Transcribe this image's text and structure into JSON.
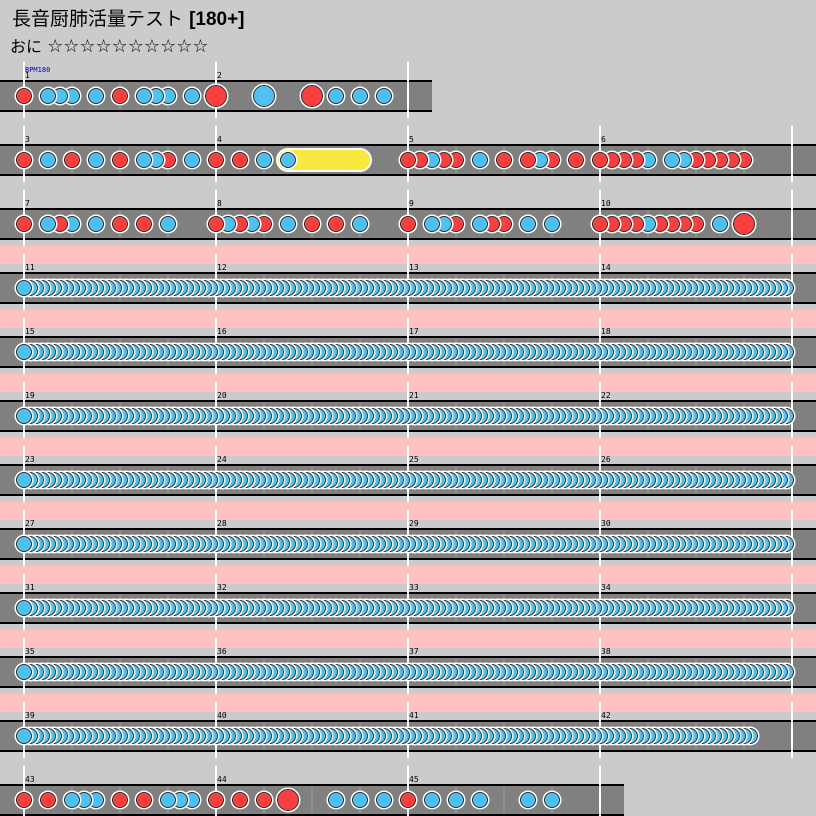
{
  "song": {
    "title": "長音厨肺活量テスト",
    "bpm_label": "[180+]"
  },
  "difficulty": {
    "name": "おに",
    "stars": "☆☆☆☆☆☆☆☆☆☆",
    "star_count": 10
  },
  "colors": {
    "background": "#cbcbcb",
    "lane": "#808080",
    "lane_border": "#000000",
    "roll_highlight": "#ffc0c0",
    "don": "#f84040",
    "ka": "#50c0f0",
    "drumroll": "#f8e840",
    "bpm_label": "#0000c0"
  },
  "chart_data": {
    "type": "taiko-chart",
    "bpm_marker": "BPM180",
    "measures_per_row": 4,
    "rows": [
      {
        "measures": [
          1,
          2
        ],
        "highlight": false,
        "notes": [
          {
            "m": 1,
            "p": 0.0,
            "t": "don"
          },
          {
            "m": 1,
            "p": 0.125,
            "t": "ka"
          },
          {
            "m": 1,
            "p": 0.1875,
            "t": "ka"
          },
          {
            "m": 1,
            "p": 0.25,
            "t": "ka"
          },
          {
            "m": 1,
            "p": 0.375,
            "t": "ka"
          },
          {
            "m": 1,
            "p": 0.5,
            "t": "don"
          },
          {
            "m": 1,
            "p": 0.625,
            "t": "ka"
          },
          {
            "m": 1,
            "p": 0.6875,
            "t": "ka"
          },
          {
            "m": 1,
            "p": 0.75,
            "t": "ka"
          },
          {
            "m": 1,
            "p": 0.875,
            "t": "ka"
          },
          {
            "m": 2,
            "p": 0.0,
            "t": "DON"
          },
          {
            "m": 2,
            "p": 0.25,
            "t": "KA"
          },
          {
            "m": 2,
            "p": 0.5,
            "t": "DON"
          },
          {
            "m": 2,
            "p": 0.625,
            "t": "ka"
          },
          {
            "m": 2,
            "p": 0.75,
            "t": "ka"
          },
          {
            "m": 2,
            "p": 0.875,
            "t": "ka"
          }
        ]
      },
      {
        "measures": [
          3,
          4,
          5,
          6
        ],
        "highlight": false,
        "rolls": [
          {
            "m": 4,
            "start": 0.375,
            "end": 0.75
          }
        ],
        "notes": [
          {
            "m": 3,
            "p": 0.0,
            "t": "don"
          },
          {
            "m": 3,
            "p": 0.125,
            "t": "ka"
          },
          {
            "m": 3,
            "p": 0.25,
            "t": "don"
          },
          {
            "m": 3,
            "p": 0.375,
            "t": "ka"
          },
          {
            "m": 3,
            "p": 0.5,
            "t": "don"
          },
          {
            "m": 3,
            "p": 0.625,
            "t": "ka"
          },
          {
            "m": 3,
            "p": 0.6875,
            "t": "ka"
          },
          {
            "m": 3,
            "p": 0.75,
            "t": "don"
          },
          {
            "m": 3,
            "p": 0.875,
            "t": "ka"
          },
          {
            "m": 4,
            "p": 0.0,
            "t": "don"
          },
          {
            "m": 4,
            "p": 0.125,
            "t": "don"
          },
          {
            "m": 4,
            "p": 0.25,
            "t": "ka"
          },
          {
            "m": 4,
            "p": 0.375,
            "t": "ka"
          },
          {
            "m": 5,
            "p": 0.0,
            "t": "don"
          },
          {
            "m": 5,
            "p": 0.0625,
            "t": "don"
          },
          {
            "m": 5,
            "p": 0.125,
            "t": "ka"
          },
          {
            "m": 5,
            "p": 0.1875,
            "t": "don"
          },
          {
            "m": 5,
            "p": 0.25,
            "t": "don"
          },
          {
            "m": 5,
            "p": 0.375,
            "t": "ka"
          },
          {
            "m": 5,
            "p": 0.5,
            "t": "don"
          },
          {
            "m": 5,
            "p": 0.625,
            "t": "don"
          },
          {
            "m": 5,
            "p": 0.6875,
            "t": "ka"
          },
          {
            "m": 5,
            "p": 0.75,
            "t": "don"
          },
          {
            "m": 5,
            "p": 0.875,
            "t": "don"
          },
          {
            "m": 6,
            "p": 0.0,
            "t": "don"
          },
          {
            "m": 6,
            "p": 0.0625,
            "t": "don"
          },
          {
            "m": 6,
            "p": 0.125,
            "t": "don"
          },
          {
            "m": 6,
            "p": 0.1875,
            "t": "don"
          },
          {
            "m": 6,
            "p": 0.25,
            "t": "ka"
          },
          {
            "m": 6,
            "p": 0.375,
            "t": "ka"
          },
          {
            "m": 6,
            "p": 0.4375,
            "t": "ka"
          },
          {
            "m": 6,
            "p": 0.5,
            "t": "don"
          },
          {
            "m": 6,
            "p": 0.5625,
            "t": "don"
          },
          {
            "m": 6,
            "p": 0.625,
            "t": "don"
          },
          {
            "m": 6,
            "p": 0.6875,
            "t": "don"
          },
          {
            "m": 6,
            "p": 0.75,
            "t": "don"
          }
        ]
      },
      {
        "measures": [
          7,
          8,
          9,
          10
        ],
        "highlight": false,
        "notes": [
          {
            "m": 7,
            "p": 0.0,
            "t": "don"
          },
          {
            "m": 7,
            "p": 0.125,
            "t": "ka"
          },
          {
            "m": 7,
            "p": 0.1875,
            "t": "don"
          },
          {
            "m": 7,
            "p": 0.25,
            "t": "ka"
          },
          {
            "m": 7,
            "p": 0.375,
            "t": "ka"
          },
          {
            "m": 7,
            "p": 0.5,
            "t": "don"
          },
          {
            "m": 7,
            "p": 0.625,
            "t": "don"
          },
          {
            "m": 7,
            "p": 0.75,
            "t": "ka"
          },
          {
            "m": 8,
            "p": 0.0,
            "t": "don"
          },
          {
            "m": 8,
            "p": 0.0625,
            "t": "ka"
          },
          {
            "m": 8,
            "p": 0.125,
            "t": "don"
          },
          {
            "m": 8,
            "p": 0.1875,
            "t": "ka"
          },
          {
            "m": 8,
            "p": 0.25,
            "t": "don"
          },
          {
            "m": 8,
            "p": 0.375,
            "t": "ka"
          },
          {
            "m": 8,
            "p": 0.5,
            "t": "don"
          },
          {
            "m": 8,
            "p": 0.625,
            "t": "don"
          },
          {
            "m": 8,
            "p": 0.75,
            "t": "ka"
          },
          {
            "m": 9,
            "p": 0.0,
            "t": "don"
          },
          {
            "m": 9,
            "p": 0.125,
            "t": "ka"
          },
          {
            "m": 9,
            "p": 0.1875,
            "t": "ka"
          },
          {
            "m": 9,
            "p": 0.25,
            "t": "don"
          },
          {
            "m": 9,
            "p": 0.375,
            "t": "ka"
          },
          {
            "m": 9,
            "p": 0.4375,
            "t": "don"
          },
          {
            "m": 9,
            "p": 0.5,
            "t": "don"
          },
          {
            "m": 9,
            "p": 0.625,
            "t": "ka"
          },
          {
            "m": 9,
            "p": 0.75,
            "t": "ka"
          },
          {
            "m": 10,
            "p": 0.0,
            "t": "don"
          },
          {
            "m": 10,
            "p": 0.0625,
            "t": "don"
          },
          {
            "m": 10,
            "p": 0.125,
            "t": "don"
          },
          {
            "m": 10,
            "p": 0.1875,
            "t": "don"
          },
          {
            "m": 10,
            "p": 0.25,
            "t": "ka"
          },
          {
            "m": 10,
            "p": 0.3125,
            "t": "don"
          },
          {
            "m": 10,
            "p": 0.375,
            "t": "don"
          },
          {
            "m": 10,
            "p": 0.4375,
            "t": "don"
          },
          {
            "m": 10,
            "p": 0.5,
            "t": "don"
          },
          {
            "m": 10,
            "p": 0.625,
            "t": "ka"
          },
          {
            "m": 10,
            "p": 0.75,
            "t": "DON"
          }
        ]
      },
      {
        "measures": [
          11,
          12,
          13,
          14
        ],
        "highlight": true,
        "stream": {
          "t": "ka",
          "count": 128
        }
      },
      {
        "measures": [
          15,
          16,
          17,
          18
        ],
        "highlight": true,
        "stream": {
          "t": "ka",
          "count": 128
        }
      },
      {
        "measures": [
          19,
          20,
          21,
          22
        ],
        "highlight": true,
        "stream": {
          "t": "ka",
          "count": 128
        }
      },
      {
        "measures": [
          23,
          24,
          25,
          26
        ],
        "highlight": true,
        "stream": {
          "t": "ka",
          "count": 128
        }
      },
      {
        "measures": [
          27,
          28,
          29,
          30
        ],
        "highlight": true,
        "stream": {
          "t": "ka",
          "count": 128
        }
      },
      {
        "measures": [
          31,
          32,
          33,
          34
        ],
        "highlight": true,
        "stream": {
          "t": "ka",
          "count": 128
        }
      },
      {
        "measures": [
          35,
          36,
          37,
          38
        ],
        "highlight": true,
        "stream": {
          "t": "ka",
          "count": 128
        }
      },
      {
        "measures": [
          39,
          40,
          41,
          42
        ],
        "highlight": true,
        "stream": {
          "t": "ka",
          "count": 122
        }
      },
      {
        "measures": [
          43,
          44,
          45
        ],
        "highlight": false,
        "notes": [
          {
            "m": 43,
            "p": 0.0,
            "t": "don"
          },
          {
            "m": 43,
            "p": 0.125,
            "t": "don"
          },
          {
            "m": 43,
            "p": 0.25,
            "t": "ka"
          },
          {
            "m": 43,
            "p": 0.3125,
            "t": "ka"
          },
          {
            "m": 43,
            "p": 0.375,
            "t": "ka"
          },
          {
            "m": 43,
            "p": 0.5,
            "t": "don"
          },
          {
            "m": 43,
            "p": 0.625,
            "t": "don"
          },
          {
            "m": 43,
            "p": 0.75,
            "t": "ka"
          },
          {
            "m": 43,
            "p": 0.8125,
            "t": "ka"
          },
          {
            "m": 43,
            "p": 0.875,
            "t": "ka"
          },
          {
            "m": 44,
            "p": 0.0,
            "t": "don"
          },
          {
            "m": 44,
            "p": 0.125,
            "t": "don"
          },
          {
            "m": 44,
            "p": 0.25,
            "t": "don"
          },
          {
            "m": 44,
            "p": 0.375,
            "t": "DON"
          },
          {
            "m": 44,
            "p": 0.625,
            "t": "ka"
          },
          {
            "m": 44,
            "p": 0.75,
            "t": "ka"
          },
          {
            "m": 44,
            "p": 0.875,
            "t": "ka"
          },
          {
            "m": 45,
            "p": 0.0,
            "t": "don"
          },
          {
            "m": 45,
            "p": 0.125,
            "t": "ka"
          },
          {
            "m": 45,
            "p": 0.25,
            "t": "ka"
          },
          {
            "m": 45,
            "p": 0.375,
            "t": "ka"
          },
          {
            "m": 45,
            "p": 0.625,
            "t": "ka"
          },
          {
            "m": 45,
            "p": 0.75,
            "t": "ka"
          }
        ]
      }
    ]
  }
}
